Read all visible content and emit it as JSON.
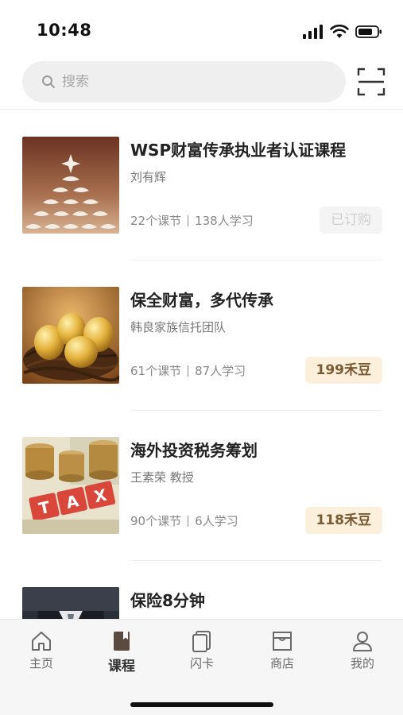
{
  "status_bar": {
    "time": "10:48"
  },
  "search": {
    "placeholder": "搜索"
  },
  "courses": [
    {
      "title": "WSP财富传承执业者认证课程",
      "author": "刘有辉",
      "lessons": "22个课节",
      "learners": "138人学习",
      "price": "已订购",
      "state": "owned",
      "thumb": "pinecone"
    },
    {
      "title": "保全财富，多代传承",
      "author": "韩良家族信托团队",
      "lessons": "61个课节",
      "learners": "87人学习",
      "price": "199禾豆",
      "state": "buy",
      "thumb": "golden-eggs"
    },
    {
      "title": "海外投资税务筹划",
      "author": "王素荣 教授",
      "lessons": "90个课节",
      "learners": "6人学习",
      "price": "118禾豆",
      "state": "buy",
      "thumb": "tax-coins"
    },
    {
      "title": "保险8分钟",
      "author": "",
      "lessons": "",
      "learners": "",
      "price": "",
      "state": "partial",
      "thumb": "suit-person"
    }
  ],
  "tabs": [
    {
      "label": "主页",
      "icon": "home-icon",
      "active": false
    },
    {
      "label": "课程",
      "icon": "book-icon",
      "active": true
    },
    {
      "label": "闪卡",
      "icon": "flashcard-icon",
      "active": false
    },
    {
      "label": "商店",
      "icon": "store-icon",
      "active": false
    },
    {
      "label": "我的",
      "icon": "user-icon",
      "active": false
    }
  ],
  "colors": {
    "accent_badge_bg": "#fcf0dc",
    "accent_badge_text": "#7a5a32",
    "tabbar_bg": "#f6f6f6"
  }
}
